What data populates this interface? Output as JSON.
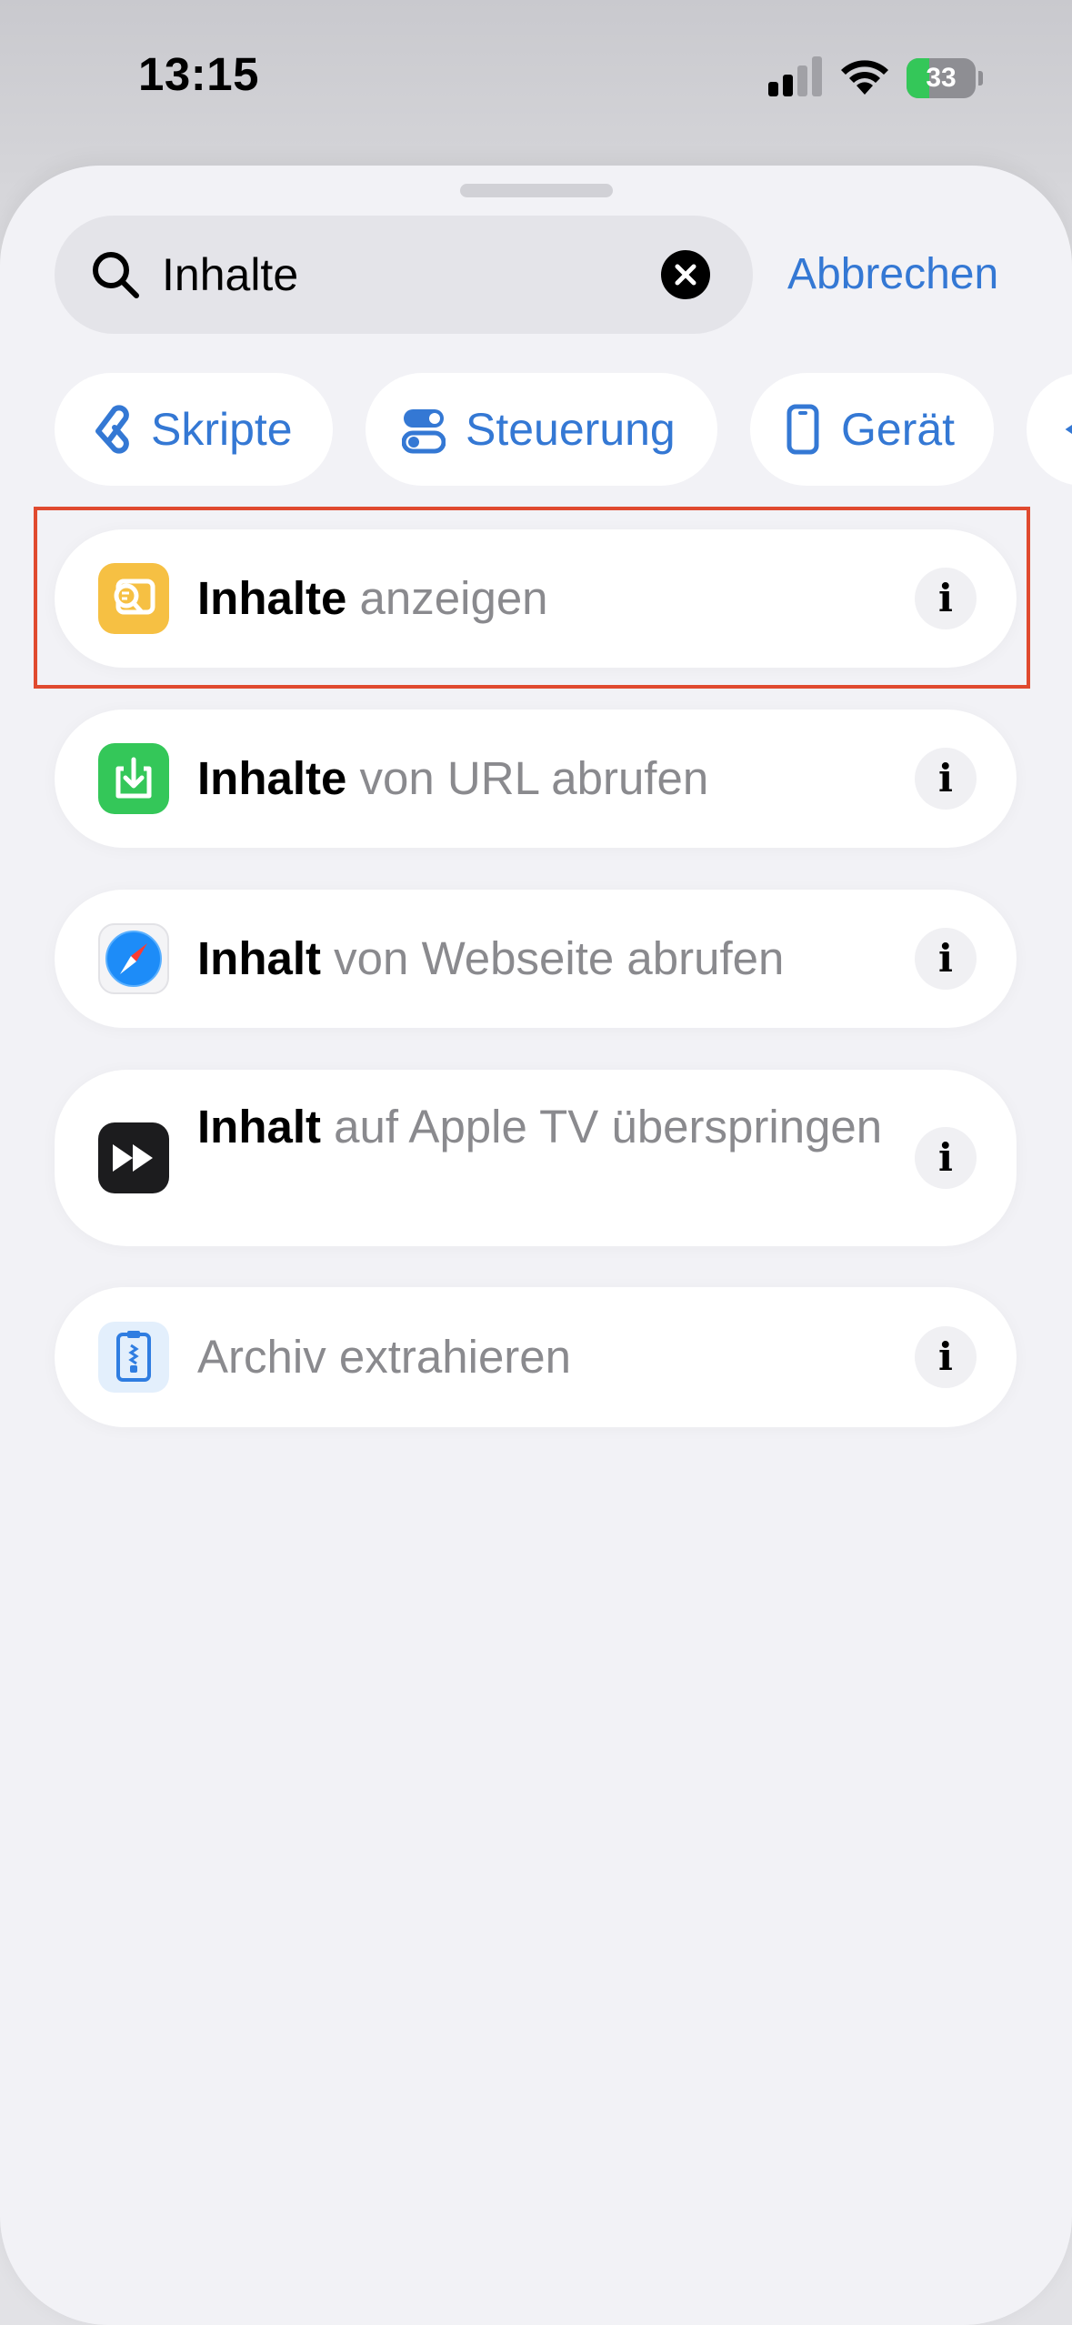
{
  "status_bar": {
    "time": "13:15",
    "battery_percent": "33",
    "battery_level": 0.33,
    "battery_color": "#34c759"
  },
  "search": {
    "value": "Inhalte",
    "cancel_label": "Abbrechen",
    "icon": "magnifying-glass",
    "clear_icon": "xmark-circle-fill"
  },
  "categories": [
    {
      "label": "Skripte",
      "icon": "scripting-icon"
    },
    {
      "label": "Steuerung",
      "icon": "toggle-icon"
    },
    {
      "label": "Gerät",
      "icon": "iphone-icon"
    }
  ],
  "results": [
    {
      "keyword": "Inhalte",
      "rest": "anzeigen",
      "icon": "quick-look-icon",
      "icon_color": "#f6c043",
      "highlighted": true
    },
    {
      "keyword": "Inhalte",
      "rest": "von URL abrufen",
      "icon": "download-icon",
      "icon_color": "#34c759",
      "highlighted": false
    },
    {
      "keyword": "Inhalt",
      "rest": "von Webseite abrufen",
      "icon": "safari-icon",
      "icon_color": "#1d8cf8",
      "highlighted": false
    },
    {
      "keyword": "Inhalt",
      "rest": "auf Apple TV überspringen",
      "icon": "skip-forward-icon",
      "icon_color": "#1c1c1e",
      "highlighted": false
    },
    {
      "keyword": "",
      "rest": "Archiv extrahieren",
      "icon": "zip-archive-icon",
      "icon_color": "#2f7de1",
      "highlighted": false
    }
  ],
  "info_label": "i",
  "accent_color": "#3478d4",
  "highlight_color": "#e04a2f"
}
